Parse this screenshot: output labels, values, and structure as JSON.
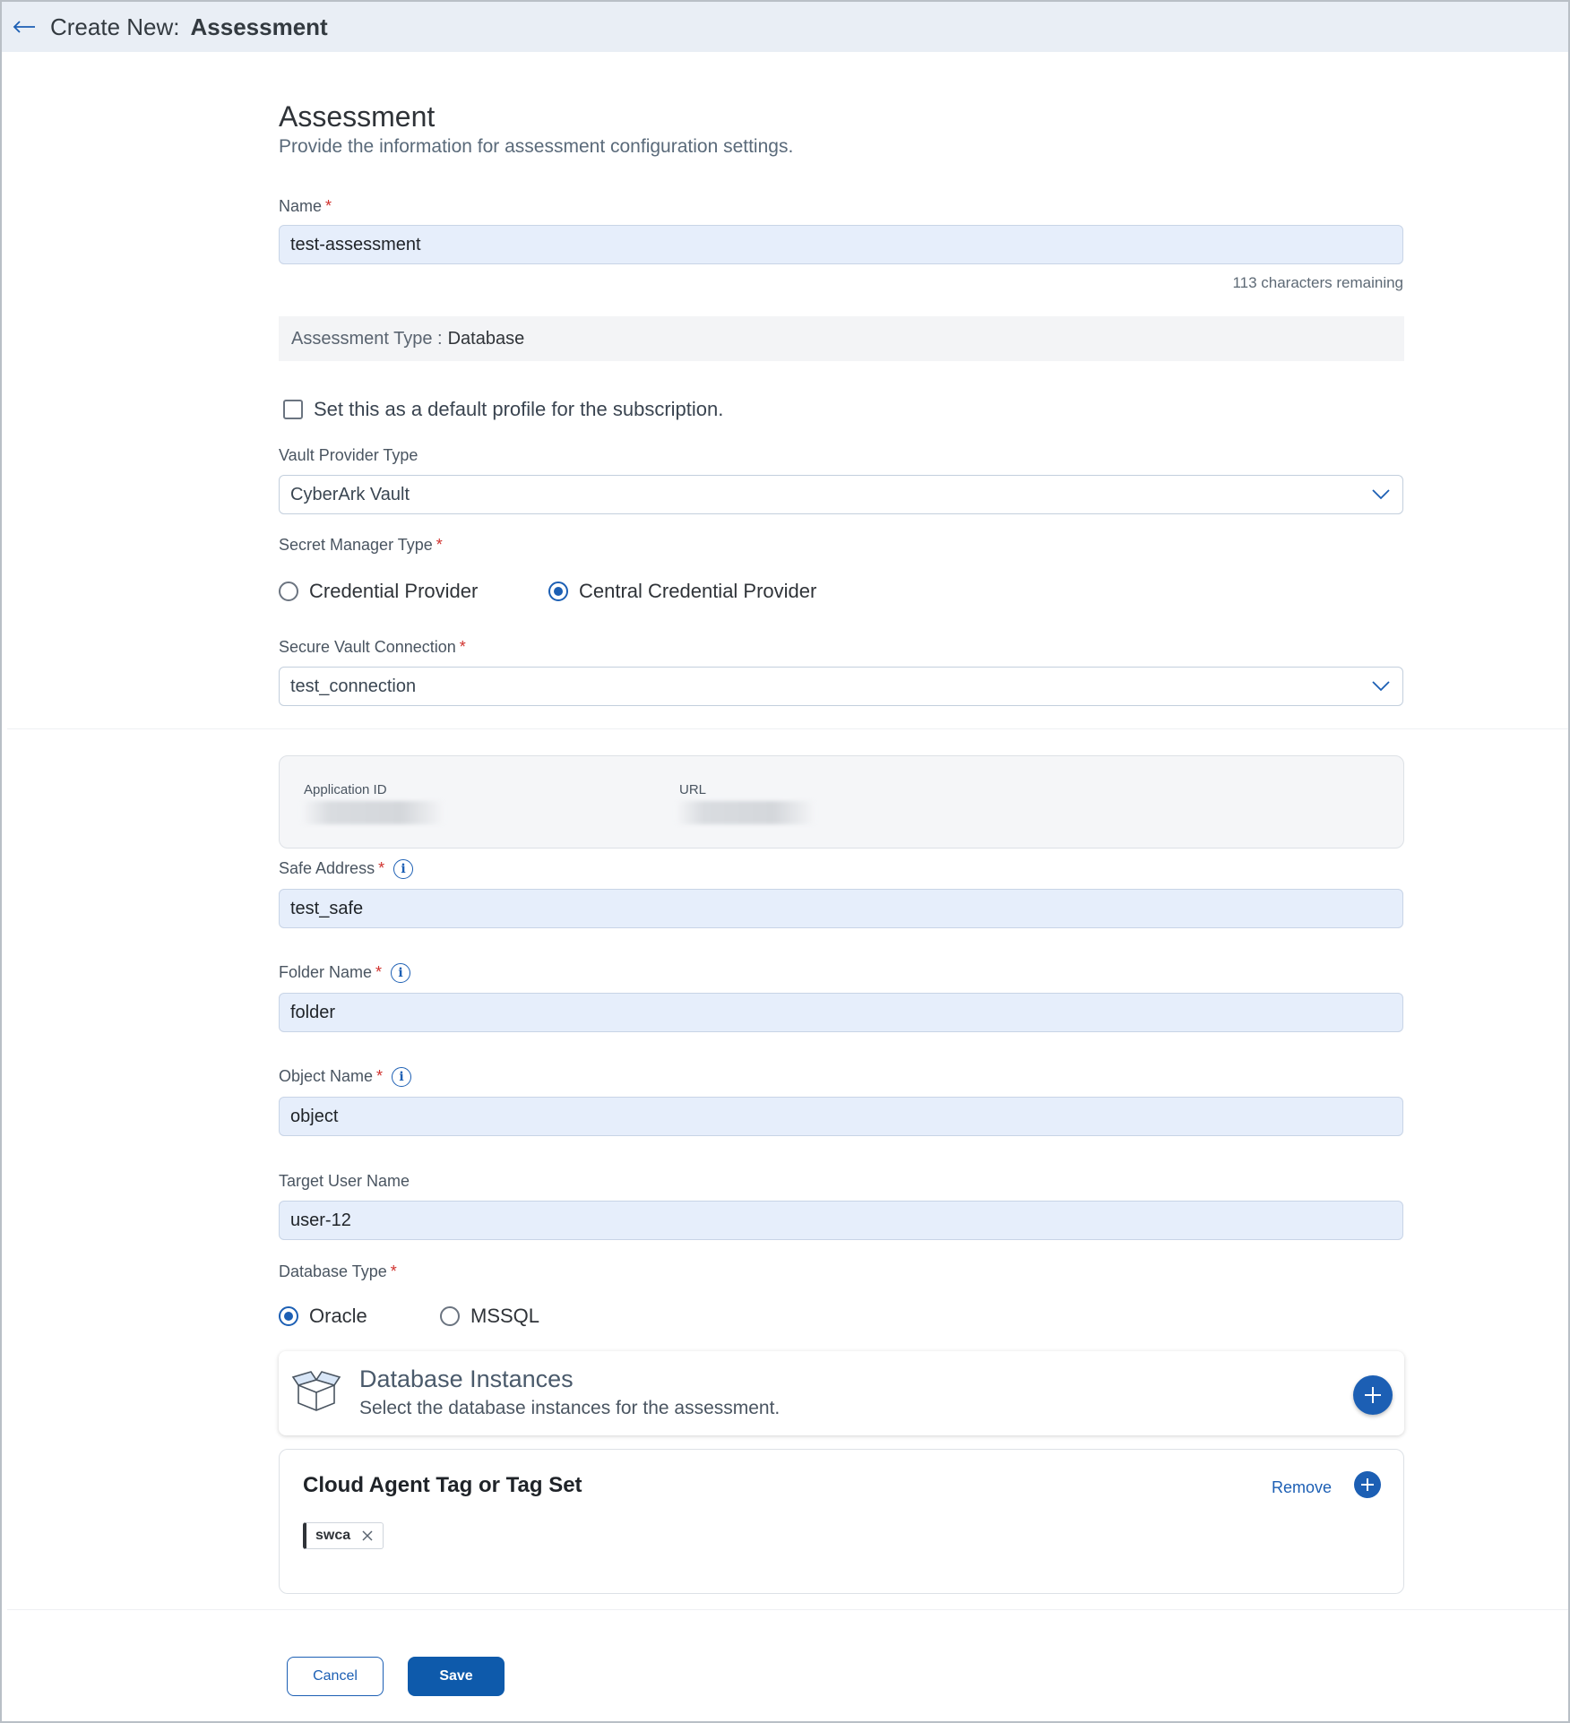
{
  "header": {
    "prefix": "Create New:",
    "title": "Assessment"
  },
  "section": {
    "title": "Assessment",
    "subtitle": "Provide the information for assessment configuration settings."
  },
  "name_field": {
    "label": "Name",
    "value": "test-assessment",
    "remaining": "113 characters remaining"
  },
  "assessment_type": {
    "label": "Assessment Type :",
    "value": "Database"
  },
  "default_profile": {
    "label": "Set this as a default profile for the subscription.",
    "checked": false
  },
  "vault_provider": {
    "label": "Vault Provider Type",
    "value": "CyberArk Vault"
  },
  "secret_manager": {
    "label": "Secret Manager Type",
    "options": [
      "Credential Provider",
      "Central Credential Provider"
    ],
    "selected": "Central Credential Provider"
  },
  "vault_connection": {
    "label": "Secure Vault Connection",
    "value": "test_connection"
  },
  "connection_info": {
    "app_id_label": "Application ID",
    "url_label": "URL"
  },
  "safe_address": {
    "label": "Safe Address",
    "value": "test_safe"
  },
  "folder_name": {
    "label": "Folder Name",
    "value": "folder"
  },
  "object_name": {
    "label": "Object Name",
    "value": "object"
  },
  "target_user": {
    "label": "Target User Name",
    "value": "user-12"
  },
  "database_type": {
    "label": "Database Type",
    "options": [
      "Oracle",
      "MSSQL"
    ],
    "selected": "Oracle"
  },
  "db_instances": {
    "title": "Database Instances",
    "subtitle": "Select the database instances for the assessment."
  },
  "cloud_agent": {
    "title": "Cloud Agent Tag or Tag Set",
    "remove_label": "Remove",
    "tags": [
      "swca"
    ]
  },
  "footer": {
    "cancel_label": "Cancel",
    "save_label": "Save"
  },
  "colors": {
    "accent": "#1c5fb4",
    "input_bg": "#e6eefb",
    "required": "#d0312d"
  },
  "icons": [
    "back-arrow-icon",
    "chevron-down-icon",
    "info-icon",
    "open-box-icon",
    "plus-icon",
    "close-icon"
  ]
}
